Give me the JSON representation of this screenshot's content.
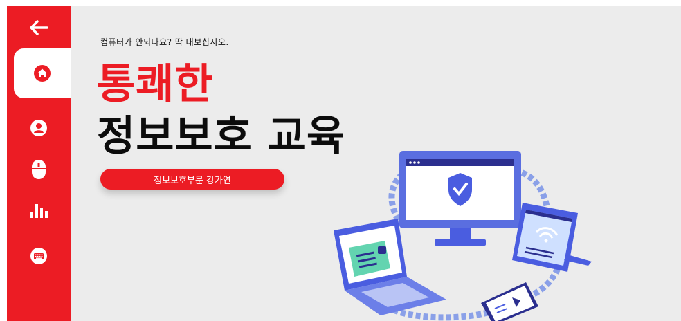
{
  "sidebar": {
    "items": [
      {
        "icon": "arrow-left-icon"
      },
      {
        "icon": "home-icon",
        "active": true
      },
      {
        "icon": "user-icon"
      },
      {
        "icon": "mouse-icon"
      },
      {
        "icon": "bar-chart-icon"
      },
      {
        "icon": "keyboard-icon"
      }
    ]
  },
  "slide": {
    "subtitle": "컴퓨터가 안되나요? 딱 대보십시오.",
    "title_line1": "통쾌한",
    "title_line2": "정보보호 교육",
    "presenter": "정보보호부문 강가연"
  },
  "colors": {
    "accent": "#ec1c24",
    "background": "#ececec",
    "text": "#0c0c0c"
  }
}
